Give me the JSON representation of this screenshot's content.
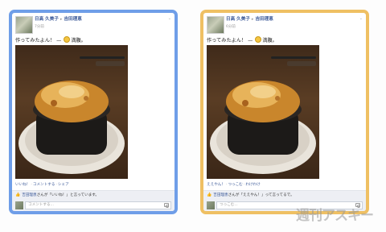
{
  "cards": [
    {
      "author": "日高 久美子",
      "separator": "▸",
      "target": "吉田理恵",
      "time": "7分前",
      "caret": "⌄",
      "message_before": "作ってみたよん！ — ",
      "message_after": "満腹。",
      "actions": [
        "いいね！",
        "コメントする",
        "シェア"
      ],
      "likes_name": "吉田理恵",
      "likes_text": "さんが「いいね！」と言っています。",
      "comment_placeholder": "コメントする..."
    },
    {
      "author": "日高 久美子",
      "separator": "▸",
      "target": "吉田理恵",
      "time": "6分前",
      "caret": "⌄",
      "message_before": "作ってみたよん！ — ",
      "message_after": "満腹。",
      "actions": [
        "ええやん！",
        "つっこむ",
        "わけわけ"
      ],
      "likes_name": "吉田理恵",
      "likes_text": "さんが「ええやん！」って言ってるで。",
      "comment_placeholder": "つっこむ..."
    }
  ],
  "watermark": "週刊アスキー",
  "colors": {
    "left_border": "#6f9ee8",
    "right_border": "#efc063",
    "link": "#3b5998"
  }
}
